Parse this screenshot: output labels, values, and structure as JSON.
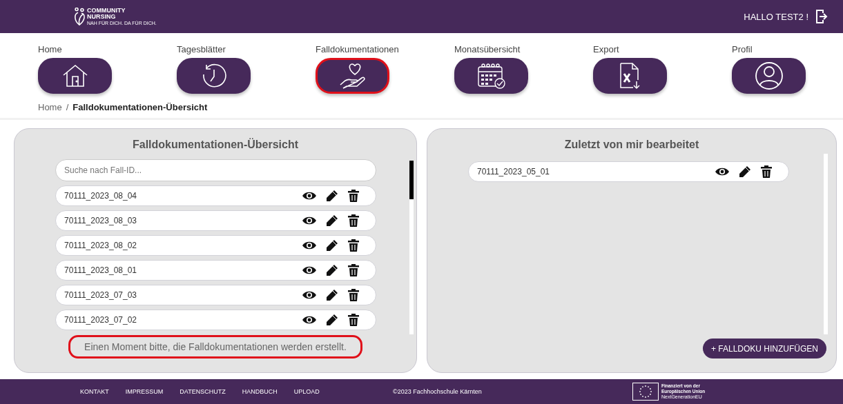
{
  "header": {
    "logo": {
      "line_1": "COMMUNITY",
      "line_2": "NURSING",
      "tagline": "NAH FÜR DICH. DA FÜR DICH."
    },
    "greeting": "HALLO TEST2 !"
  },
  "nav": [
    {
      "label": "Home",
      "kind": "home",
      "selected": false
    },
    {
      "label": "Tagesblätter",
      "kind": "clock",
      "selected": false
    },
    {
      "label": "Falldokumentationen",
      "kind": "care",
      "selected": true
    },
    {
      "label": "Monatsübersicht",
      "kind": "calendar",
      "selected": false
    },
    {
      "label": "Export",
      "kind": "export",
      "selected": false
    },
    {
      "label": "Profil",
      "kind": "profile",
      "selected": false
    }
  ],
  "breadcrumb": {
    "home": "Home",
    "separator": "/",
    "current": "Falldokumentationen-Übersicht"
  },
  "overview_panel": {
    "title": "Falldokumentationen-Übersicht",
    "search": {
      "placeholder": "Suche nach Fall-ID..."
    },
    "cases": [
      {
        "id": "70111_2023_08_04"
      },
      {
        "id": "70111_2023_08_03"
      },
      {
        "id": "70111_2023_08_02"
      },
      {
        "id": "70111_2023_08_01"
      },
      {
        "id": "70111_2023_07_03"
      },
      {
        "id": "70111_2023_07_02"
      }
    ],
    "notice": {
      "text": "Einen Moment bitte, die Falldokumentationen werden erstellt.",
      "highlighted": true
    }
  },
  "recent_panel": {
    "title": "Zuletzt von mir bearbeitet",
    "cases": [
      {
        "id": "70111_2023_05_01"
      }
    ],
    "add_button": "+ FALLDOKU HINZUFÜGEN"
  },
  "footer": {
    "links": [
      "KONTAKT",
      "IMPRESSUM",
      "DATENSCHUTZ",
      "HANDBUCH",
      "UPLOAD"
    ],
    "copyright": "©2023 Fachhochschule Kärnten",
    "eu_badge": {
      "line_1": "Finanziert von der",
      "line_2": "Europäischen Union",
      "line_3": "NextGenerationEU"
    }
  }
}
